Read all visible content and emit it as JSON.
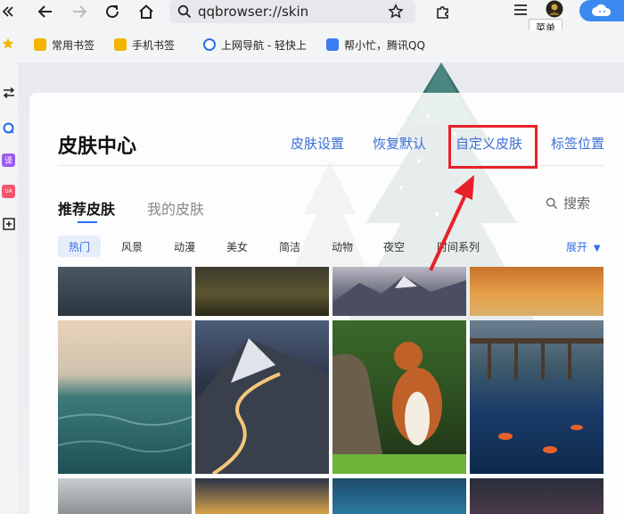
{
  "browser": {
    "url": "qqbrowser://skin",
    "menu_tooltip": "菜单"
  },
  "bookmarks": [
    {
      "label": "常用书签",
      "icon": "bookmark-folder-icon",
      "color": "#f4b400"
    },
    {
      "label": "手机书签",
      "icon": "bookmark-folder-icon",
      "color": "#f4b400"
    },
    {
      "label": "上网导航 - 轻快上",
      "icon": "qq-browser-icon",
      "color": "#2f6fe8"
    },
    {
      "label": "帮小忙，腾讯QQ",
      "icon": "helper-icon",
      "color": "#3b7cf0"
    }
  ],
  "sidebar_icons": [
    "swap-icon",
    "qq-icon",
    "translate-icon",
    "shop-icon",
    "add-icon"
  ],
  "skin_center": {
    "title": "皮肤中心",
    "links": [
      "皮肤设置",
      "恢复默认",
      "自定义皮肤",
      "标签位置"
    ],
    "tabs": [
      "推荐皮肤",
      "我的皮肤"
    ],
    "active_tab": 0,
    "search_label": "搜索",
    "categories": [
      "热门",
      "风景",
      "动漫",
      "美女",
      "简洁",
      "动物",
      "夜空",
      "时间系列"
    ],
    "active_category": 0,
    "expand_label": "展开"
  },
  "colors": {
    "accent": "#2f6fe8",
    "highlight_box": "#e8202a"
  }
}
